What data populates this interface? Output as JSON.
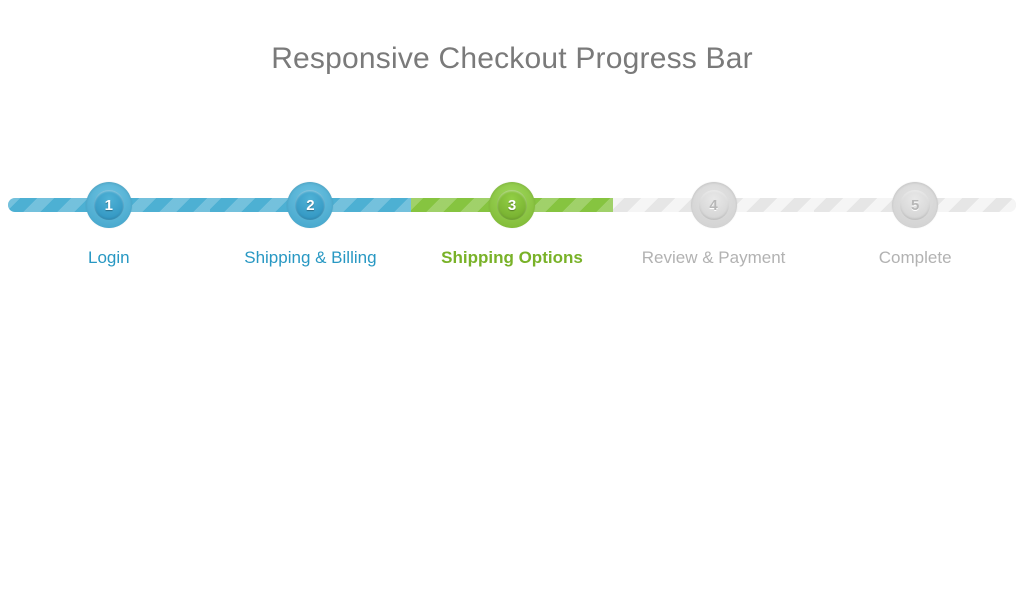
{
  "title": "Responsive Checkout Progress Bar",
  "colors": {
    "visited": "#4db0d3",
    "current": "#86c440",
    "pending": "#e6e6e6",
    "title": "#7a7a7a"
  },
  "segments": [
    "visited",
    "visited",
    "current",
    "pending",
    "pending"
  ],
  "steps": [
    {
      "num": "1",
      "label": "Login",
      "state": "visited"
    },
    {
      "num": "2",
      "label": "Shipping & Billing",
      "state": "visited"
    },
    {
      "num": "3",
      "label": "Shipping Options",
      "state": "current"
    },
    {
      "num": "4",
      "label": "Review & Payment",
      "state": "pending"
    },
    {
      "num": "5",
      "label": "Complete",
      "state": "pending"
    }
  ]
}
